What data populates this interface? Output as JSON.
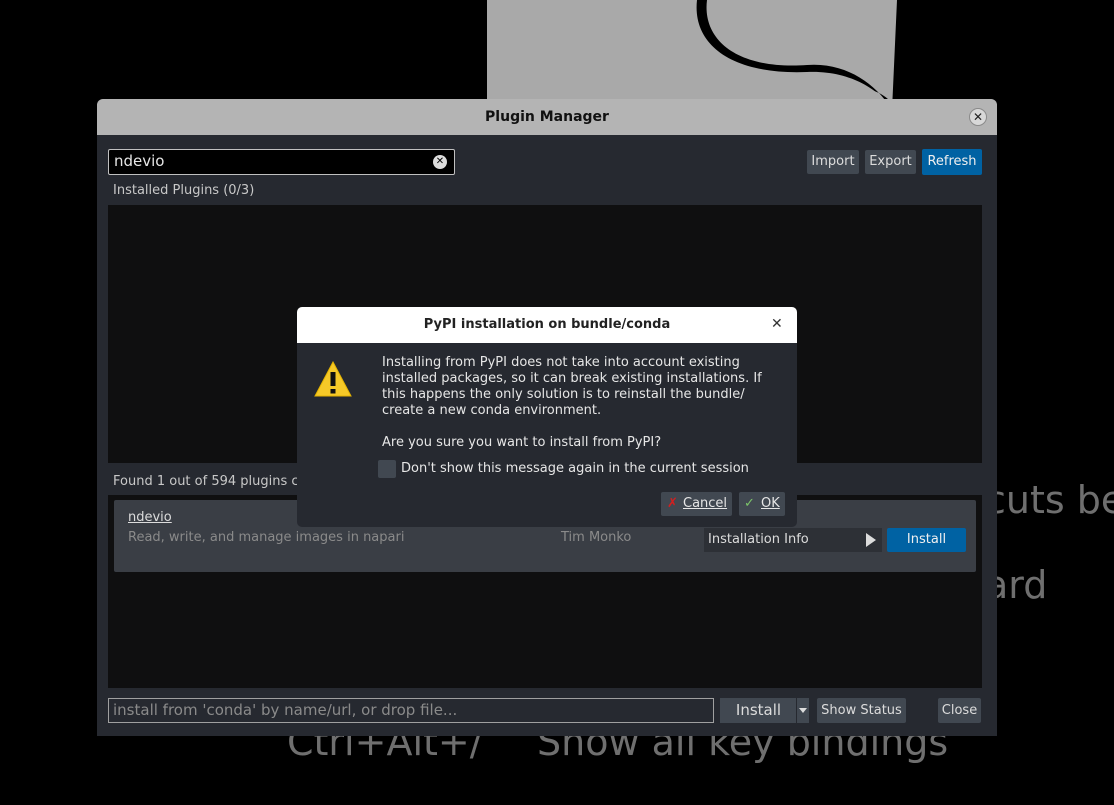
{
  "background": {
    "text_line_1": "cuts be",
    "text_line_2": "ard",
    "shortcut_keys": "Ctrl+Alt+/",
    "shortcut_desc": "Show all key bindings"
  },
  "window": {
    "title": "Plugin Manager",
    "close_glyph": "✕"
  },
  "search": {
    "value": "ndevio",
    "clear_glyph": "✕"
  },
  "toolbar": {
    "import_label": "Import",
    "export_label": "Export",
    "refresh_label": "Refresh"
  },
  "installed": {
    "header": "Installed Plugins (0/3)"
  },
  "available": {
    "header": "Found 1 out of 594 plugins c",
    "items": [
      {
        "name": "ndevio",
        "description": "Read, write, and manage images in napari",
        "author": "Tim Monko",
        "info_label": "Installation Info",
        "install_label": "Install"
      }
    ]
  },
  "bottom": {
    "input_placeholder": "install from 'conda' by name/url, or drop file...",
    "install_label": "Install",
    "status_label": "Show Status",
    "close_label": "Close"
  },
  "dialog": {
    "title": "PyPI installation on bundle/conda",
    "close_glyph": "✕",
    "message": "Installing from PyPI does not take into account existing installed packages, so it can break existing installations. If this happens the only solution is to reinstall the bundle/ create a new conda environment.",
    "question": "Are you sure you want to install from PyPI?",
    "checkbox_label": "Don't show this message again in the current session",
    "cancel_label": "Cancel",
    "ok_label": "OK"
  },
  "colors": {
    "accent": "#0062a3",
    "warning": "#f6c928",
    "cancel_icon": "#d21f1f",
    "ok_icon": "#7cc46a"
  }
}
